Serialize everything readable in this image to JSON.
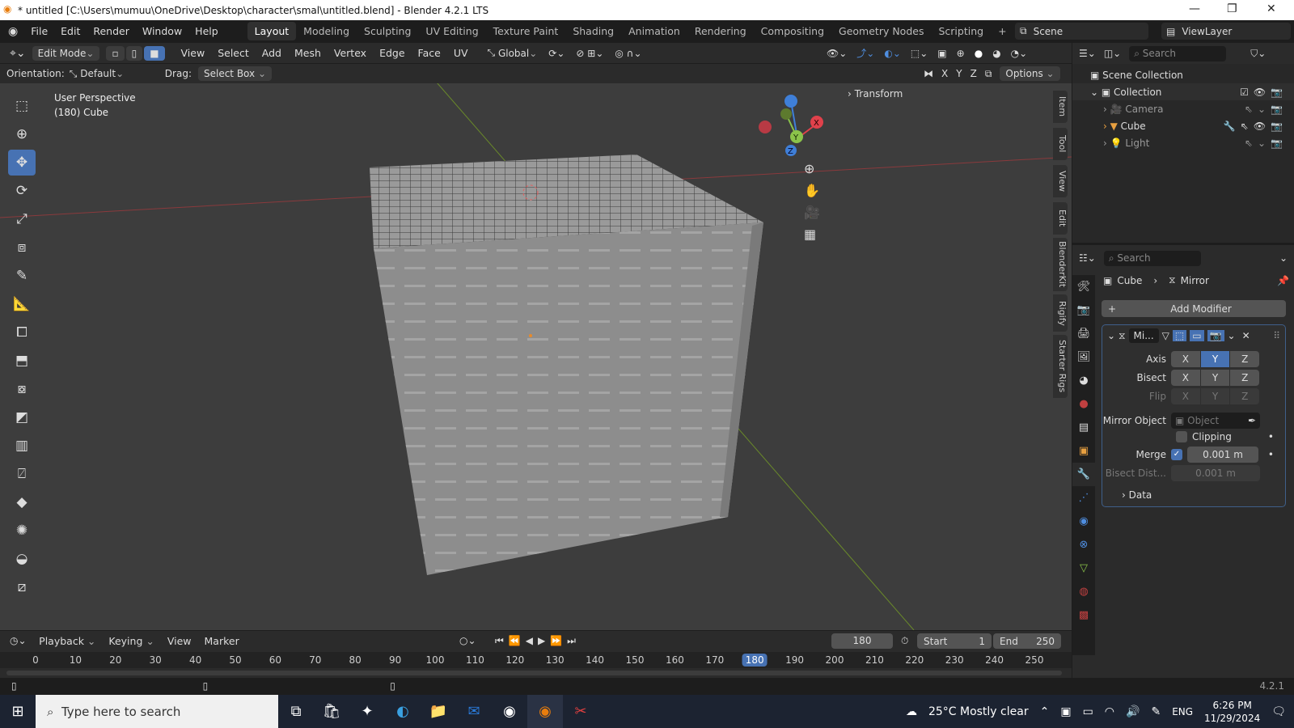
{
  "window": {
    "title": "* untitled [C:\\Users\\mumuu\\OneDrive\\Desktop\\character\\smal\\untitled.blend] - Blender 4.2.1 LTS",
    "minimize": "—",
    "maximize": "❐",
    "close": "✕"
  },
  "menu": [
    "File",
    "Edit",
    "Render",
    "Window",
    "Help"
  ],
  "workspaces": [
    {
      "label": "Layout",
      "active": true
    },
    {
      "label": "Modeling"
    },
    {
      "label": "Sculpting"
    },
    {
      "label": "UV Editing"
    },
    {
      "label": "Texture Paint"
    },
    {
      "label": "Shading"
    },
    {
      "label": "Animation"
    },
    {
      "label": "Rendering"
    },
    {
      "label": "Compositing"
    },
    {
      "label": "Geometry Nodes"
    },
    {
      "label": "Scripting"
    },
    {
      "label": "+"
    }
  ],
  "scene": {
    "label": "Scene",
    "viewlayer": "ViewLayer"
  },
  "header": {
    "mode": "Edit Mode",
    "menus": [
      "View",
      "Select",
      "Add",
      "Mesh",
      "Vertex",
      "Edge",
      "Face",
      "UV"
    ],
    "transform_orientation": "Global"
  },
  "toolsettings": {
    "orientation_label": "Orientation:",
    "orientation_value": "Default",
    "drag_label": "Drag:",
    "drag_value": "Select Box",
    "axes": [
      "X",
      "Y",
      "Z"
    ],
    "options": "Options"
  },
  "viewport": {
    "view_name": "User Perspective",
    "object_info": "(180) Cube",
    "transform_panel": "Transform",
    "gizmo": {
      "x": "X",
      "y": "Y",
      "z": "Z"
    }
  },
  "side_tabs": [
    "Item",
    "Tool",
    "View",
    "Edit",
    "BlenderKit",
    "Rigify",
    "Starter Rigs"
  ],
  "tools": [
    "select-box",
    "cursor",
    "move",
    "rotate",
    "scale",
    "transform",
    "annotate",
    "measure",
    "add-cube",
    "extrude",
    "inset",
    "bevel",
    "loop-cut",
    "knife",
    "poly-build",
    "spin",
    "smooth",
    "shear"
  ],
  "outliner": {
    "search_placeholder": "Search",
    "root": "Scene Collection",
    "collection": "Collection",
    "objects": [
      "Camera",
      "Cube",
      "Light"
    ]
  },
  "properties": {
    "search_placeholder": "Search",
    "breadcrumb_object": "Cube",
    "breadcrumb_modifier": "Mirror",
    "add_modifier": "Add Modifier",
    "modifier": {
      "name": "Mi...",
      "axis_label": "Axis",
      "bisect_label": "Bisect",
      "flip_label": "Flip",
      "axes": [
        "X",
        "Y",
        "Z"
      ],
      "axis_active": "Y",
      "mirror_object_label": "Mirror Object",
      "mirror_object_placeholder": "Object",
      "clipping_label": "Clipping",
      "clipping": false,
      "merge_label": "Merge",
      "merge": true,
      "merge_value": "0.001 m",
      "bisect_dist_label": "Bisect Dist...",
      "bisect_dist_value": "0.001 m",
      "data_label": "Data"
    }
  },
  "timeline": {
    "menus": [
      "Playback",
      "Keying",
      "View",
      "Marker"
    ],
    "current_frame": "180",
    "start_label": "Start",
    "start": "1",
    "end_label": "End",
    "end": "250",
    "ticks": [
      "0",
      "10",
      "20",
      "30",
      "40",
      "50",
      "60",
      "70",
      "80",
      "90",
      "100",
      "110",
      "120",
      "130",
      "140",
      "150",
      "160",
      "170",
      "180",
      "190",
      "200",
      "210",
      "220",
      "230",
      "240",
      "250"
    ]
  },
  "status": {
    "version": "4.2.1"
  },
  "taskbar": {
    "search_placeholder": "Type here to search",
    "weather": "25°C  Mostly clear",
    "lang": "ENG",
    "time": "6:26 PM",
    "date": "11/29/2024"
  },
  "colors": {
    "accent": "#4772b3",
    "viewport": "#3d3d3d",
    "x_axis": "#e0414b",
    "y_axis": "#8bc34a",
    "z_axis": "#3f7fd8"
  }
}
